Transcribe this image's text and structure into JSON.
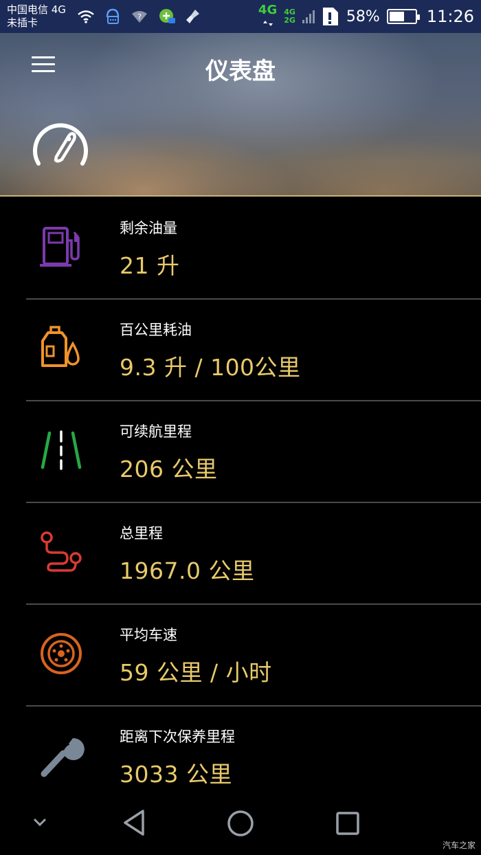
{
  "status_bar": {
    "carrier_line1": "中国电信 4G",
    "carrier_line2": "未插卡",
    "network_main": "4G",
    "network_small_top": "4G",
    "network_small_bottom": "2G",
    "battery_percent": "58%",
    "battery_level": 0.58,
    "time": "11:26"
  },
  "header": {
    "title": "仪表盘",
    "menu_icon": "hamburger-menu-icon",
    "gauge_icon": "speedometer-icon"
  },
  "items": [
    {
      "label": "剩余油量",
      "value": "21 升",
      "icon": "fuel-pump-icon",
      "color": "#7c3aad"
    },
    {
      "label": "百公里耗油",
      "value": "9.3 升 / 100公里",
      "icon": "oil-can-drop-icon",
      "color": "#f0932b"
    },
    {
      "label": "可续航里程",
      "value": "206 公里",
      "icon": "road-icon",
      "color": "#27a844"
    },
    {
      "label": "总里程",
      "value": "1967.0 公里",
      "icon": "route-icon",
      "color": "#d93a34"
    },
    {
      "label": "平均车速",
      "value": "59 公里 / 小时",
      "icon": "wheel-icon",
      "color": "#d8641f"
    },
    {
      "label": "距离下次保养里程",
      "value": "3033 公里",
      "icon": "wrench-icon",
      "color": "#7a8796"
    }
  ],
  "nav": {
    "down": "chevron-down-icon",
    "back": "back-triangle-icon",
    "home": "home-circle-icon",
    "recents": "recents-square-icon"
  },
  "watermark": "汽车之家",
  "colors": {
    "accent_value": "#e8ca6a",
    "status_bar": "#1c2a57",
    "network": "#3fce3f"
  }
}
